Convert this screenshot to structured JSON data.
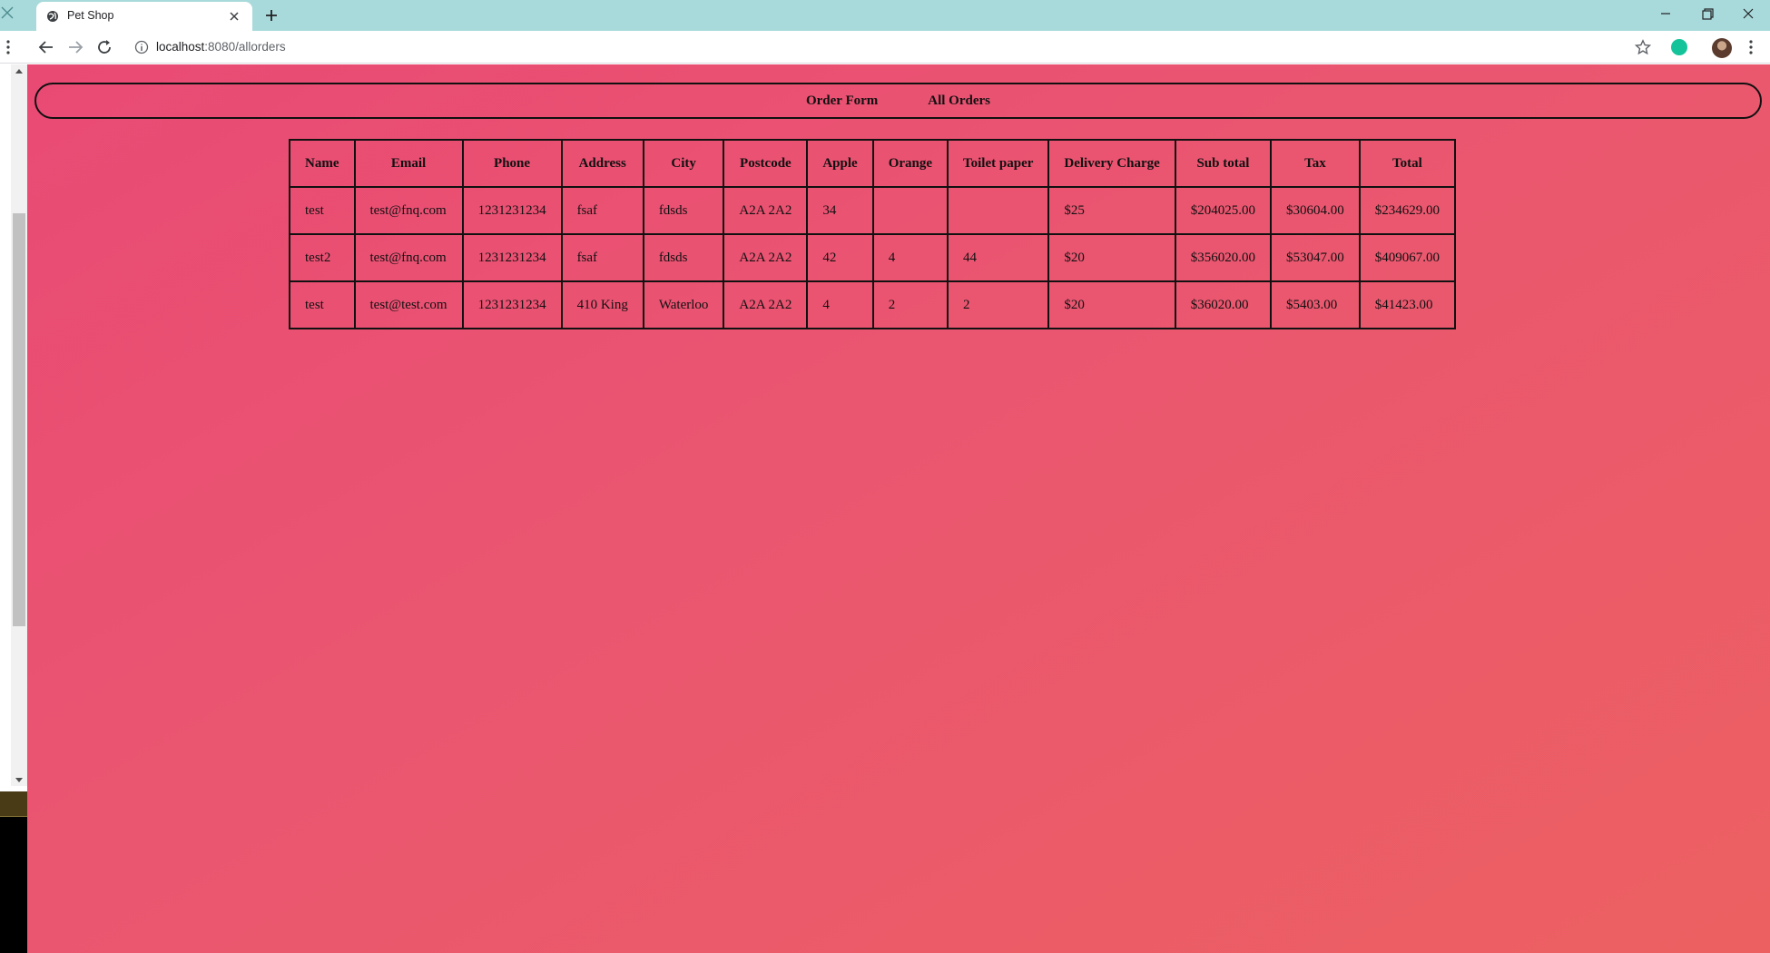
{
  "browser": {
    "tab_title": "Pet Shop",
    "url_host": "localhost",
    "url_path": ":8080/allorders"
  },
  "nav": {
    "links": [
      "Order Form",
      "All Orders"
    ]
  },
  "orders": {
    "headers": [
      "Name",
      "Email",
      "Phone",
      "Address",
      "City",
      "Postcode",
      "Apple",
      "Orange",
      "Toilet paper",
      "Delivery Charge",
      "Sub total",
      "Tax",
      "Total"
    ],
    "rows": [
      [
        "test",
        "test@fnq.com",
        "1231231234",
        "fsaf",
        "fdsds",
        "A2A 2A2",
        "34",
        "",
        "",
        "$25",
        "$204025.00",
        "$30604.00",
        "$234629.00"
      ],
      [
        "test2",
        "test@fnq.com",
        "1231231234",
        "fsaf",
        "fdsds",
        "A2A 2A2",
        "42",
        "4",
        "44",
        "$20",
        "$356020.00",
        "$53047.00",
        "$409067.00"
      ],
      [
        "test",
        "test@test.com",
        "1231231234",
        "410 King",
        "Waterloo",
        "A2A 2A2",
        "4",
        "2",
        "2",
        "$20",
        "$36020.00",
        "$5403.00",
        "$41423.00"
      ]
    ]
  },
  "icons": {
    "tabbar": [
      "close-icon",
      "globe-icon",
      "plus-icon",
      "minimize-icon",
      "restore-icon"
    ],
    "toolbar": [
      "menu-dots-icon",
      "back-arrow-icon",
      "forward-arrow-icon",
      "reload-icon",
      "info-icon",
      "star-icon",
      "grammarly-icon",
      "avatar"
    ]
  },
  "colors": {
    "tabbar": "#a9dadb",
    "page_gradient_start": "#e94a74",
    "page_gradient_end": "#ec6061"
  }
}
